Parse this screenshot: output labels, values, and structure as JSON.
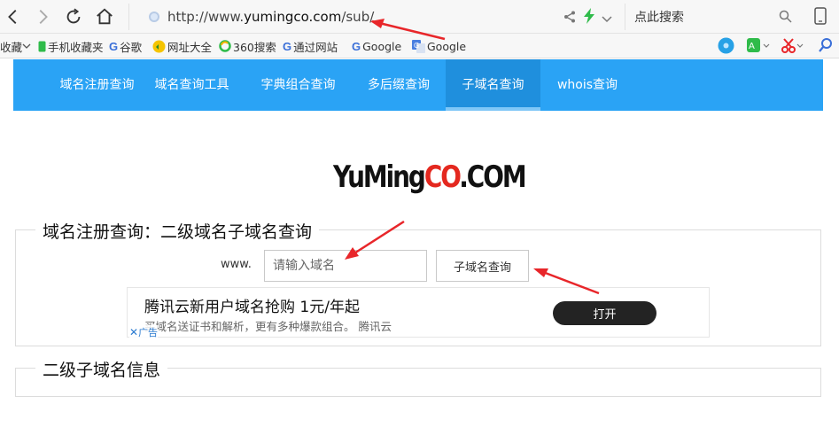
{
  "browser": {
    "url_prefix": "http://www.",
    "url_domain": "yumingco.com",
    "url_path": "/sub/",
    "search_placeholder": "点此搜索",
    "icons": [
      "back-icon",
      "forward-icon",
      "reload-icon",
      "home-icon",
      "globe-icon",
      "share-icon",
      "lightning-icon",
      "chevron-down-icon",
      "search-icon",
      "tablet-icon"
    ]
  },
  "bookmarks": {
    "items": [
      {
        "label": "收藏",
        "icon": "chevron-down-icon"
      },
      {
        "label": "手机收藏夹",
        "icon": "phone-icon"
      },
      {
        "label": "谷歌",
        "icon": "google-icon"
      },
      {
        "label": "网址大全",
        "icon": "web-directory-icon"
      },
      {
        "label": "360搜索",
        "icon": "search-360-icon"
      },
      {
        "label": "通过网站",
        "icon": "google-icon"
      },
      {
        "label": "Google",
        "icon": "google-icon"
      },
      {
        "label": "Google",
        "icon": "translate-icon"
      }
    ]
  },
  "site_nav": {
    "items": [
      {
        "label": "域名注册查询",
        "active": false
      },
      {
        "label": "域名查询工具",
        "active": false
      },
      {
        "label": "字典组合查询",
        "active": false
      },
      {
        "label": "多后缀查询",
        "active": false
      },
      {
        "label": "子域名查询",
        "active": true
      },
      {
        "label": "whois查询",
        "active": false
      }
    ]
  },
  "logo": {
    "part1": "YuMing",
    "part2": "CO",
    "part3": ".COM"
  },
  "query_panel": {
    "legend": "域名注册查询：二级域名子域名查询",
    "prefix": "www.",
    "input_placeholder": "请输入域名",
    "button_label": "子域名查询"
  },
  "ad": {
    "title": "腾讯云新用户域名抢购 1元/年起",
    "description": "买域名送证书和解析，更有多种爆款组合。 腾讯云",
    "button_label": "打开",
    "close_mark": "✕",
    "badge": "广告"
  },
  "info_panel": {
    "legend": "二级子域名信息"
  },
  "colors": {
    "nav_bg": "#2aa3f5",
    "nav_active": "#1f8fdd",
    "logo_red": "#e4281f",
    "arrow": "#e8262a"
  }
}
